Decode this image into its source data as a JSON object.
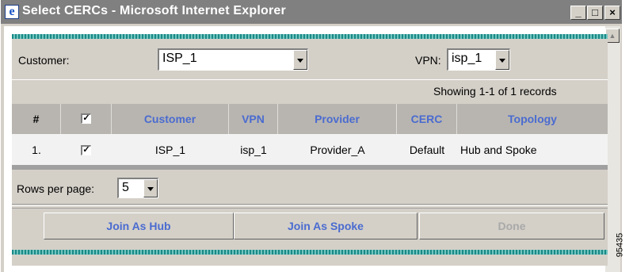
{
  "window": {
    "title": "Select CERCs - Microsoft Internet Explorer",
    "controls": {
      "minimize": "_",
      "maximize": "□",
      "close": "×"
    }
  },
  "filters": {
    "customer_label": "Customer:",
    "customer_value": "ISP_1",
    "vpn_label": "VPN:",
    "vpn_value": "isp_1"
  },
  "records_info": "Showing 1-1 of 1 records",
  "table": {
    "headers": [
      "#",
      "Customer",
      "VPN",
      "Provider",
      "CERC",
      "Topology"
    ],
    "header_checkbox_checked": true,
    "rows": [
      {
        "index": "1.",
        "checked": true,
        "customer": "ISP_1",
        "vpn": "isp_1",
        "provider": "Provider_A",
        "cerc": "Default",
        "topology": "Hub and Spoke"
      }
    ]
  },
  "pagination": {
    "rows_per_page_label": "Rows per page:",
    "rows_per_page_value": "5"
  },
  "actions": {
    "join_hub": "Join As Hub",
    "join_spoke": "Join As Spoke",
    "done": "Done"
  },
  "figure_code": "95435",
  "colors": {
    "accent_text": "#4a6bd0",
    "title_bar": "#808080",
    "stripe": "#1a8a86"
  }
}
